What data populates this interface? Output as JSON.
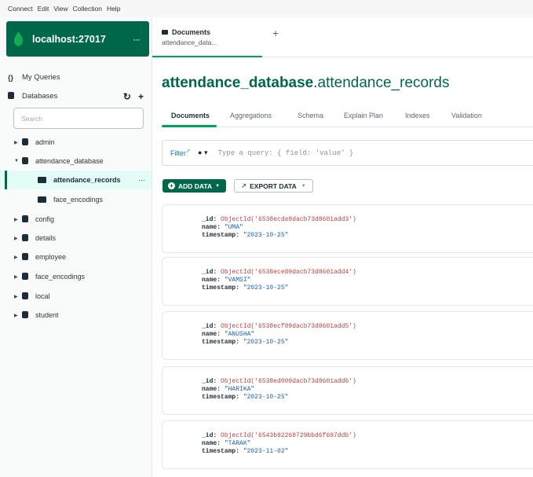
{
  "menu": [
    "Connect",
    "Edit",
    "View",
    "Collection",
    "Help"
  ],
  "connection": {
    "name": "localhost:27017",
    "more": "···"
  },
  "sidebar": {
    "my_queries": "My Queries",
    "databases": "Databases",
    "search_placeholder": "Search",
    "tree": [
      {
        "label": "admin",
        "type": "database",
        "expanded": false
      },
      {
        "label": "attendance_database",
        "type": "database",
        "expanded": true
      },
      {
        "label": "attendance_records",
        "type": "collection",
        "active": true
      },
      {
        "label": "face_encodings",
        "type": "collection"
      },
      {
        "label": "config",
        "type": "database",
        "expanded": false
      },
      {
        "label": "details",
        "type": "database",
        "expanded": false
      },
      {
        "label": "employee",
        "type": "database",
        "expanded": false
      },
      {
        "label": "face_encodings",
        "type": "database",
        "expanded": false
      },
      {
        "label": "local",
        "type": "database",
        "expanded": false
      },
      {
        "label": "student",
        "type": "database",
        "expanded": false
      }
    ],
    "row_more": "···"
  },
  "tab": {
    "title": "Documents",
    "subtitle": "attendance_data..."
  },
  "namespace": {
    "database": "attendance_database",
    "collection": ".attendance_records"
  },
  "subtabs": [
    "Documents",
    "Aggregations",
    "Schema",
    "Explain Plan",
    "Indexes",
    "Validation"
  ],
  "filter": {
    "label": "Filter",
    "placeholder": "Type a query: { field: 'value' }"
  },
  "buttons": {
    "add_data": "ADD DATA",
    "export_data": "EXPORT DATA"
  },
  "documents": [
    {
      "id_key": "_id:",
      "id": "ObjectId('6538ecda9dacb73d8601add3')",
      "name_key": "name:",
      "name": "\"UMA\"",
      "ts_key": "timestamp:",
      "timestamp": "\"2023-10-25\""
    },
    {
      "id_key": "_id:",
      "id": "ObjectId('6538ece89dacb73d8601add4')",
      "name_key": "name:",
      "name": "\"VAMSI\"",
      "ts_key": "timestamp:",
      "timestamp": "\"2023-10-25\""
    },
    {
      "id_key": "_id:",
      "id": "ObjectId('6538ecf89dacb73d8601add5')",
      "name_key": "name:",
      "name": "\"ANUSHA\"",
      "ts_key": "timestamp:",
      "timestamp": "\"2023-10-25\""
    },
    {
      "id_key": "_id:",
      "id": "ObjectId('6538ed009dacb73d8601add6')",
      "name_key": "name:",
      "name": "\"HARIKA\"",
      "ts_key": "timestamp:",
      "timestamp": "\"2023-10-25\""
    },
    {
      "id_key": "_id:",
      "id": "ObjectId('6543b92268729bbd6f697ddb')",
      "name_key": "name:",
      "name": "\"TARAK\"",
      "ts_key": "timestamp:",
      "timestamp": "\"2023-11-02\""
    }
  ],
  "colors": {
    "brand": "#00684a",
    "accent": "#00a35c",
    "active_row": "#e3fcf7"
  }
}
